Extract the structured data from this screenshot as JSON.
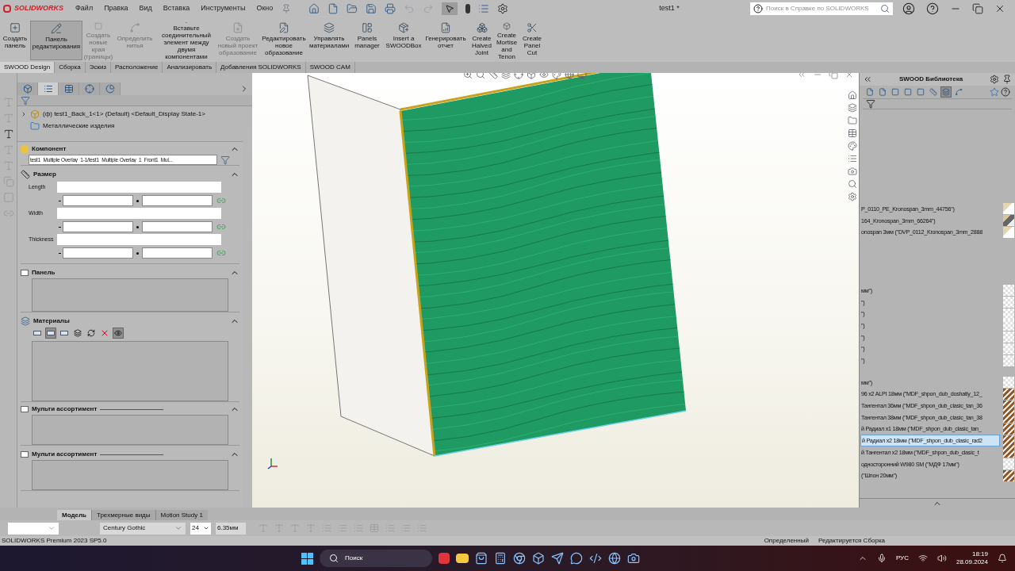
{
  "title_bar": {
    "logo": "SOLIDWORKS",
    "menus": [
      "Файл",
      "Правка",
      "Вид",
      "Вставка",
      "Инструменты",
      "Окно"
    ],
    "document_title": "test1 *",
    "help_search": {
      "placeholder": "Поиск в Справке по SOLIDWORKS"
    }
  },
  "command_bar": {
    "buttons": [
      {
        "label": "Создать панель",
        "disabled": false,
        "selected": false
      },
      {
        "label": "Панель редактирования",
        "disabled": false,
        "selected": true
      },
      {
        "label": "Создать новые края (границы)",
        "disabled": true,
        "selected": false
      },
      {
        "label": "Определить нитья",
        "disabled": true,
        "selected": false
      },
      {
        "label": "Вставьте соединительный элемент между двумя компонентами",
        "disabled": false,
        "selected": false
      },
      {
        "label": "Создать новый проект образование",
        "disabled": true,
        "selected": false
      },
      {
        "label": "Редактировать новое образование",
        "disabled": false,
        "selected": false
      },
      {
        "label": "Управлять материалами",
        "disabled": false,
        "selected": false
      },
      {
        "label": "Panels manager",
        "disabled": false,
        "selected": false
      },
      {
        "label": "Insert a SWOODBox",
        "disabled": false,
        "selected": false
      },
      {
        "label": "Генерировать отчет",
        "disabled": false,
        "selected": false
      },
      {
        "label": "Create Halved Joint",
        "disabled": false,
        "selected": false
      },
      {
        "label": "Create Mortise and Tenon",
        "disabled": false,
        "selected": false
      },
      {
        "label": "Create Panel Cut",
        "disabled": false,
        "selected": false
      }
    ]
  },
  "command_tabs": [
    {
      "label": "SWOOD Design",
      "selected": true
    },
    {
      "label": "Сборка",
      "selected": false
    },
    {
      "label": "Эскиз",
      "selected": false
    },
    {
      "label": "Расположение",
      "selected": false
    },
    {
      "label": "Анализировать",
      "selected": false
    },
    {
      "label": "Добавления SOLIDWORKS",
      "selected": false
    },
    {
      "label": "SWOOD CAM",
      "selected": false
    }
  ],
  "left_panel": {
    "tabs": [
      {
        "selected": false
      },
      {
        "selected": true
      },
      {
        "selected": false
      },
      {
        "selected": false
      },
      {
        "selected": false
      }
    ],
    "tree": [
      {
        "kind": "component",
        "label": "(ф) test1_Back_1<1> (Default) <Default_Display State-1>"
      },
      {
        "kind": "folder",
        "label": "Металлические изделия"
      }
    ],
    "sections": [
      {
        "kind": "component",
        "title": "Компонент",
        "expanded": true,
        "value": "test1_Multiple Overlay_1-1/test1_Multiple Overlay_1_Front1_Mul..."
      },
      {
        "kind": "size",
        "title": "Размер",
        "expanded": true,
        "fields": [
          "Length",
          "Width",
          "Thickness"
        ]
      },
      {
        "kind": "panel",
        "title": "Панель",
        "expanded": true
      },
      {
        "kind": "materials",
        "title": "Материалы",
        "expanded": true,
        "tools": [
          {
            "selected": false
          },
          {
            "selected": true
          },
          {
            "selected": false
          },
          {
            "selected": false
          },
          {
            "selected": false
          },
          {
            "selected": false
          },
          {
            "selected": true
          }
        ]
      },
      {
        "kind": "multi",
        "title": "Мульти ассортимент",
        "expanded": true
      },
      {
        "kind": "multi",
        "title": "Мульти ассортимент",
        "expanded": true
      }
    ]
  },
  "library": {
    "title": "SWOOD Библиотека",
    "tools": [
      {
        "selected": false
      },
      {
        "selected": false
      },
      {
        "selected": false
      },
      {
        "selected": false
      },
      {
        "selected": false
      },
      {
        "selected": false
      },
      {
        "selected": true
      },
      {
        "selected": false
      }
    ],
    "groups": [
      [
        {
          "text": "P_0110_PE_Kronospan_3mm_44756\")",
          "kind": "board",
          "selected": false
        },
        {
          "text": "164_Kronospan_3mm_66264\")",
          "kind": "dark",
          "selected": false
        },
        {
          "text": "onospan 3мм (\"DVP_0112_Kronospan_3mm_2888",
          "kind": "board",
          "selected": false
        }
      ],
      [
        {
          "text": "мм\")",
          "kind": "checker",
          "selected": false
        },
        {
          "text": "\")",
          "kind": "checker",
          "selected": false
        },
        {
          "text": "\")",
          "kind": "checker",
          "selected": false
        },
        {
          "text": "\")",
          "kind": "checker",
          "selected": false
        },
        {
          "text": "\")",
          "kind": "checker",
          "selected": false
        },
        {
          "text": "\")",
          "kind": "checker",
          "selected": false
        },
        {
          "text": "\")",
          "kind": "checker",
          "selected": false
        }
      ],
      [
        {
          "text": "мм\")",
          "kind": "checker",
          "selected": false
        },
        {
          "text": "96 x2 ALPI 18мм (\"MDF_shpon_dub_doshatiy_12_",
          "kind": "wood",
          "selected": false
        },
        {
          "text": "Тангентал 36мм (\"MDF_shpon_dub_clasic_tan_36",
          "kind": "wood",
          "selected": false
        },
        {
          "text": "Тангентал 38мм (\"MDF_shpon_dub_clasic_tan_38",
          "kind": "wood",
          "selected": false
        },
        {
          "text": "й Радиал x1 18мм (\"MDF_shpon_dub_clasic_tan_",
          "kind": "wood",
          "selected": false
        },
        {
          "text": "й Радиал x2 18мм (\"MDF_shpon_dub_clasic_rad2",
          "kind": "wood",
          "selected": true
        },
        {
          "text": "й Тангентал x2 18мм (\"MDF_shpon_dub_clasic_t",
          "kind": "wood",
          "selected": false
        },
        {
          "text": "односторонний W980 SM (\"МДФ 17мм\")",
          "kind": "checker",
          "selected": false
        },
        {
          "text": "(\"Шпон 20мм\")",
          "kind": "wood",
          "selected": false
        }
      ]
    ]
  },
  "bottom_tabs": [
    {
      "label": "Модель",
      "selected": true
    },
    {
      "label": "Трехмерные виды",
      "selected": false
    },
    {
      "label": "Motion Study 1",
      "selected": false
    }
  ],
  "format_bar": {
    "font": "Century Gothic",
    "size": "24",
    "height": "6.35мм"
  },
  "status_bar": {
    "product": "SOLIDWORKS Premium 2023 SP5.0",
    "items": [
      "Определенный",
      "Редактируется Сборка"
    ]
  },
  "taskbar": {
    "search_placeholder": "Поиск",
    "language": "РУС",
    "time": "18:19",
    "date": "28.09.2024"
  }
}
